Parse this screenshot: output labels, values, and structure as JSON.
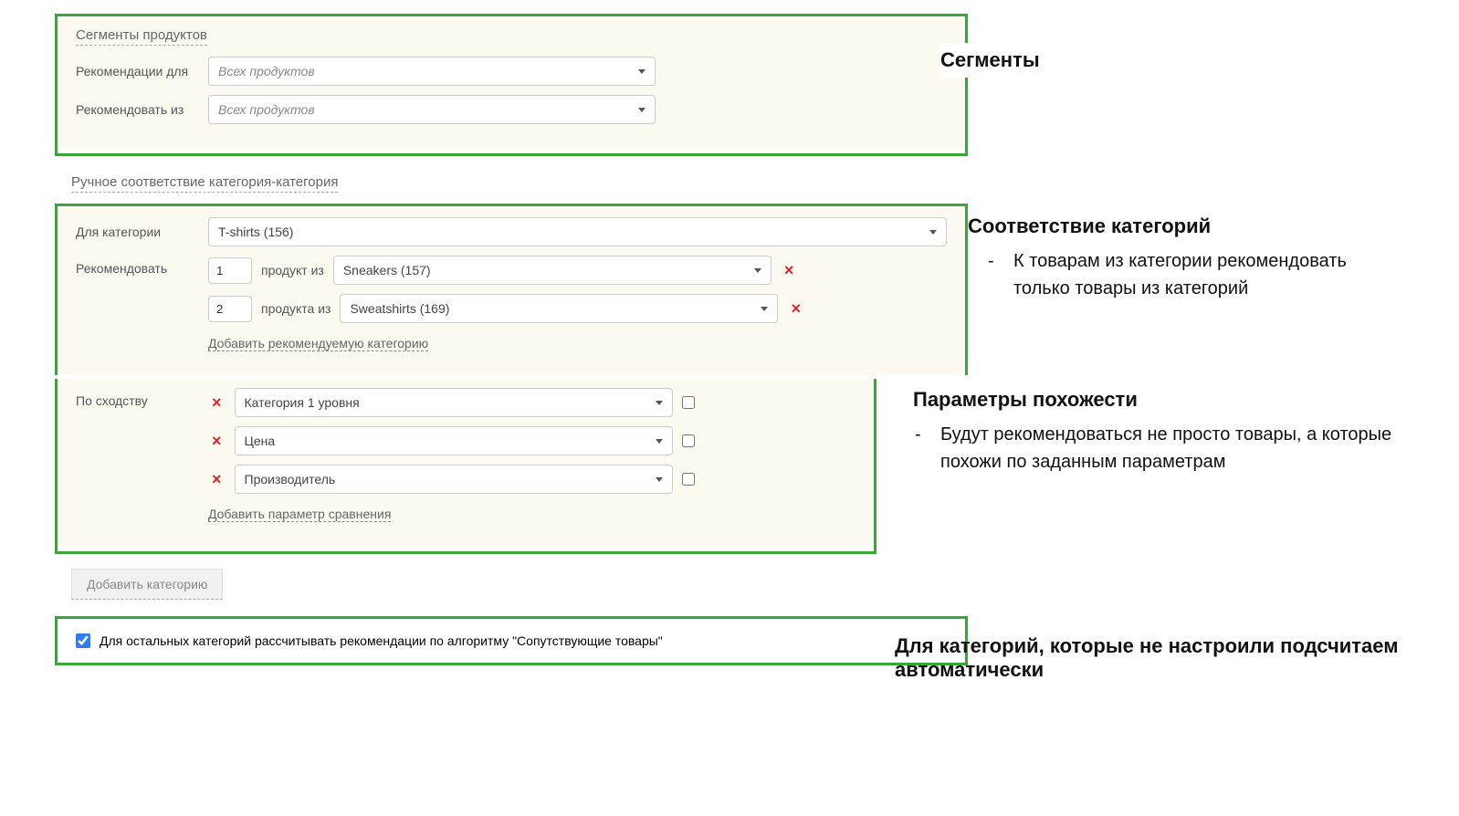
{
  "segments": {
    "title": "Сегменты продуктов",
    "rec_for_label": "Рекомендации для",
    "rec_for_value": "Всех продуктов",
    "rec_from_label": "Рекомендовать из",
    "rec_from_value": "Всех продуктов"
  },
  "manual_match": {
    "title": "Ручное соответствие категория-категория",
    "for_category_label": "Для категории",
    "for_category_value": "T-shirts (156)",
    "recommend_label": "Рекомендовать",
    "rows": [
      {
        "qty": "1",
        "word": "продукт из",
        "category": "Sneakers (157)"
      },
      {
        "qty": "2",
        "word": "продукта из",
        "category": "Sweatshirts (169)"
      }
    ],
    "add_link": "Добавить рекомендуемую категорию"
  },
  "similarity": {
    "label": "По сходству",
    "params": [
      {
        "name": "Категория 1 уровня"
      },
      {
        "name": "Цена"
      },
      {
        "name": "Производитель"
      }
    ],
    "add_link": "Добавить параметр сравнения"
  },
  "add_category_button": "Добавить категорию",
  "fallback_checkbox_label": "Для остальных категорий рассчитывать рекомендации по алгоритму \"Сопутствующие товары\"",
  "notes": {
    "n1_title": "Сегменты",
    "n2_title": "Соответствие категорий",
    "n2_bullet": "К товарам из категории рекомендовать только товары из категорий",
    "n3_title": "Параметры похожести",
    "n3_bullet": "Будут рекомендоваться не просто товары, а которые похожи по заданным параметрам",
    "n4_title": "Для категорий, которые не настроили подсчитаем автоматически"
  }
}
